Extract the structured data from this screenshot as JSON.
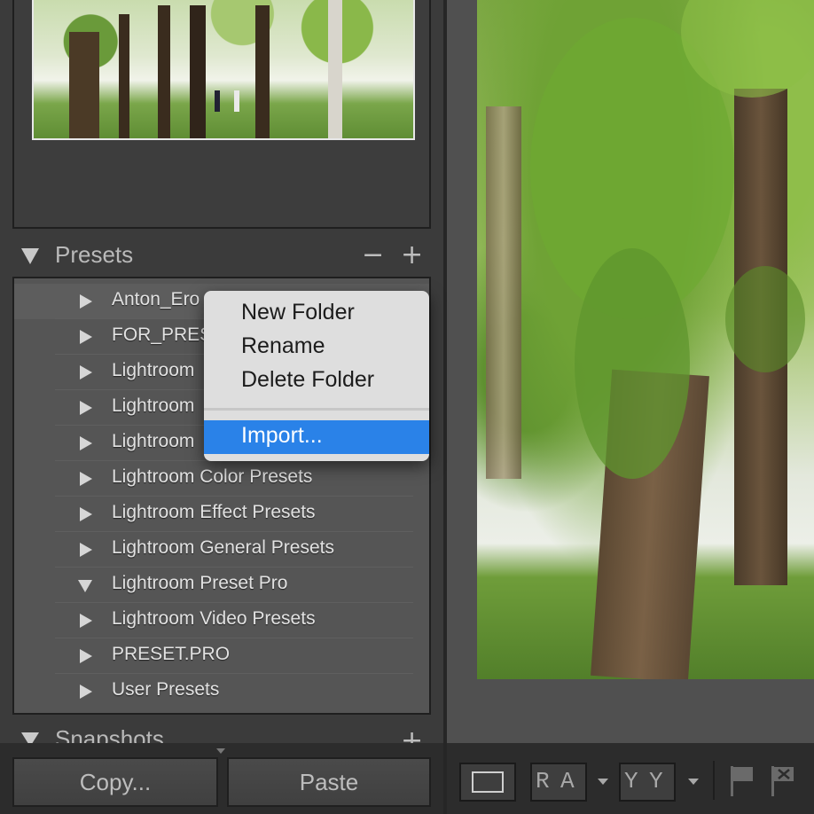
{
  "presets_panel": {
    "title": "Presets",
    "minus": "−",
    "plus": "+",
    "items": [
      {
        "label": "Anton_Ero",
        "expanded": false
      },
      {
        "label": "FOR_PRES",
        "expanded": false
      },
      {
        "label": "Lightroom",
        "expanded": false
      },
      {
        "label": "Lightroom",
        "expanded": false
      },
      {
        "label": "Lightroom",
        "expanded": false
      },
      {
        "label": "Lightroom Color Presets",
        "expanded": false
      },
      {
        "label": "Lightroom Effect Presets",
        "expanded": false
      },
      {
        "label": "Lightroom General Presets",
        "expanded": false
      },
      {
        "label": "Lightroom Preset Pro",
        "expanded": true
      },
      {
        "label": "Lightroom Video Presets",
        "expanded": false
      },
      {
        "label": "PRESET.PRO",
        "expanded": false
      },
      {
        "label": "User Presets",
        "expanded": false
      }
    ]
  },
  "context_menu": {
    "new_folder": "New Folder",
    "rename": "Rename",
    "delete_folder": "Delete Folder",
    "import": "Import..."
  },
  "snapshots_panel": {
    "title": "Snapshots",
    "plus": "+"
  },
  "buttons": {
    "copy": "Copy...",
    "paste": "Paste"
  },
  "toolbar": {
    "before_after_left": "R",
    "before_after_right": "A",
    "compare_left": "Y",
    "compare_right": "Y"
  },
  "colors": {
    "menu_highlight": "#2a82e8",
    "panel_bg": "#3b3b3b",
    "list_bg": "#555555"
  }
}
